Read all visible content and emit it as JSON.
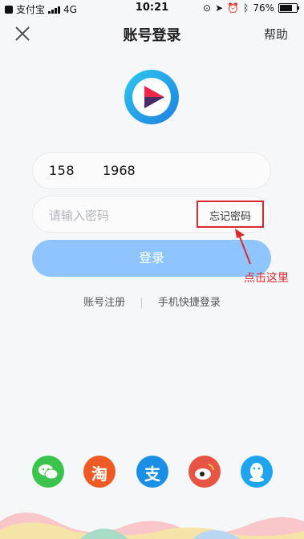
{
  "status_bar": {
    "carrier": "支付宝",
    "network": "4G",
    "time": "10:21",
    "battery": "76%"
  },
  "nav": {
    "title": "账号登录",
    "help": "帮助"
  },
  "form": {
    "phone_part1": "158",
    "phone_part2": "1968",
    "password_placeholder": "请输入密码",
    "forgot_label": "忘记密码",
    "login_label": "登录"
  },
  "links": {
    "register": "账号注册",
    "phone_login": "手机快捷登录"
  },
  "annotation": {
    "text": "点击这里"
  },
  "social": [
    {
      "name": "wechat",
      "color": "#3bc44b"
    },
    {
      "name": "taobao",
      "glyph": "淘",
      "color": "#ef5a24"
    },
    {
      "name": "alipay",
      "glyph": "支",
      "color": "#1b8fe6"
    },
    {
      "name": "weibo",
      "color": "#e85443"
    },
    {
      "name": "qq",
      "color": "#1fa5f0"
    }
  ],
  "colors": {
    "accent": "#8ec5ff",
    "annotation": "#d9282f"
  }
}
